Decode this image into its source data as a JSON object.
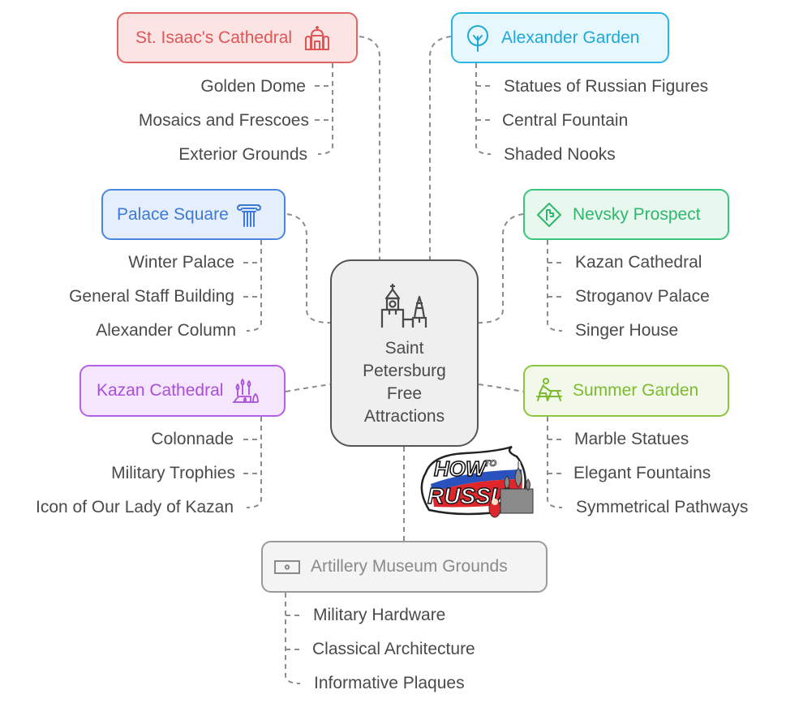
{
  "title": "Saint Petersburg Free Attractions",
  "center": {
    "title_lines": [
      "Saint",
      "Petersburg",
      "Free",
      "Attractions"
    ],
    "icon": "kremlin-towers-icon",
    "colors": {
      "border": "#555555",
      "fill": "#efefef",
      "text": "#4a4a4a"
    }
  },
  "branches": [
    {
      "id": "st-isaacs-cathedral",
      "label": "St. Isaac's Cathedral",
      "icon": "cathedral-dome-icon",
      "colors": {
        "border": "#e06666",
        "fill": "#fde4e4",
        "text": "#e05555"
      },
      "items": [
        "Golden Dome",
        "Mosaics and Frescoes",
        "Exterior Grounds"
      ]
    },
    {
      "id": "alexander-garden",
      "label": "Alexander Garden",
      "icon": "tree-icon",
      "colors": {
        "border": "#29b6e6",
        "fill": "#e6f7fd",
        "text": "#1fa8d8"
      },
      "items": [
        "Statues of Russian Figures",
        "Central Fountain",
        "Shaded Nooks"
      ]
    },
    {
      "id": "palace-square",
      "label": "Palace Square",
      "icon": "ionic-column-icon",
      "colors": {
        "border": "#4a86e0",
        "fill": "#e4eefc",
        "text": "#3d7ad8"
      },
      "items": [
        "Winter Palace",
        "General Staff Building",
        "Alexander Column"
      ]
    },
    {
      "id": "nevsky-prospect",
      "label": "Nevsky Prospect",
      "icon": "road-sign-turn-icon",
      "colors": {
        "border": "#3cc47c",
        "fill": "#e8f8ef",
        "text": "#2db86c"
      },
      "items": [
        "Kazan Cathedral",
        "Stroganov Palace",
        "Singer House"
      ]
    },
    {
      "id": "kazan-cathedral",
      "label": "Kazan Cathedral",
      "icon": "onion-domes-icon",
      "colors": {
        "border": "#b561e6",
        "fill": "#f6e6fd",
        "text": "#a94fd8"
      },
      "items": [
        "Colonnade",
        "Military Trophies",
        "Icon of Our Lady of Kazan"
      ]
    },
    {
      "id": "summer-garden",
      "label": "Summer Garden",
      "icon": "person-at-picnic-table-icon",
      "colors": {
        "border": "#8cc63f",
        "fill": "#f3f9ea",
        "text": "#7cbb2e"
      },
      "items": [
        "Marble Statues",
        "Elegant Fountains",
        "Symmetrical Pathways"
      ]
    },
    {
      "id": "artillery-museum-grounds",
      "label": "Artillery Museum Grounds",
      "icon": "cannon-screen-icon",
      "colors": {
        "border": "#9a9a9a",
        "fill": "#f4f4f4",
        "text": "#8a8a8a"
      },
      "items": [
        "Military Hardware",
        "Classical Architecture",
        "Informative Plaques"
      ]
    }
  ],
  "watermark": {
    "line1": "HOW",
    "line1_small": "TO",
    "line2": "RUSSIA",
    "flag_colors": [
      "#ffffff",
      "#2a52be",
      "#e0262b"
    ]
  },
  "connector_color": "#8c8c8c"
}
